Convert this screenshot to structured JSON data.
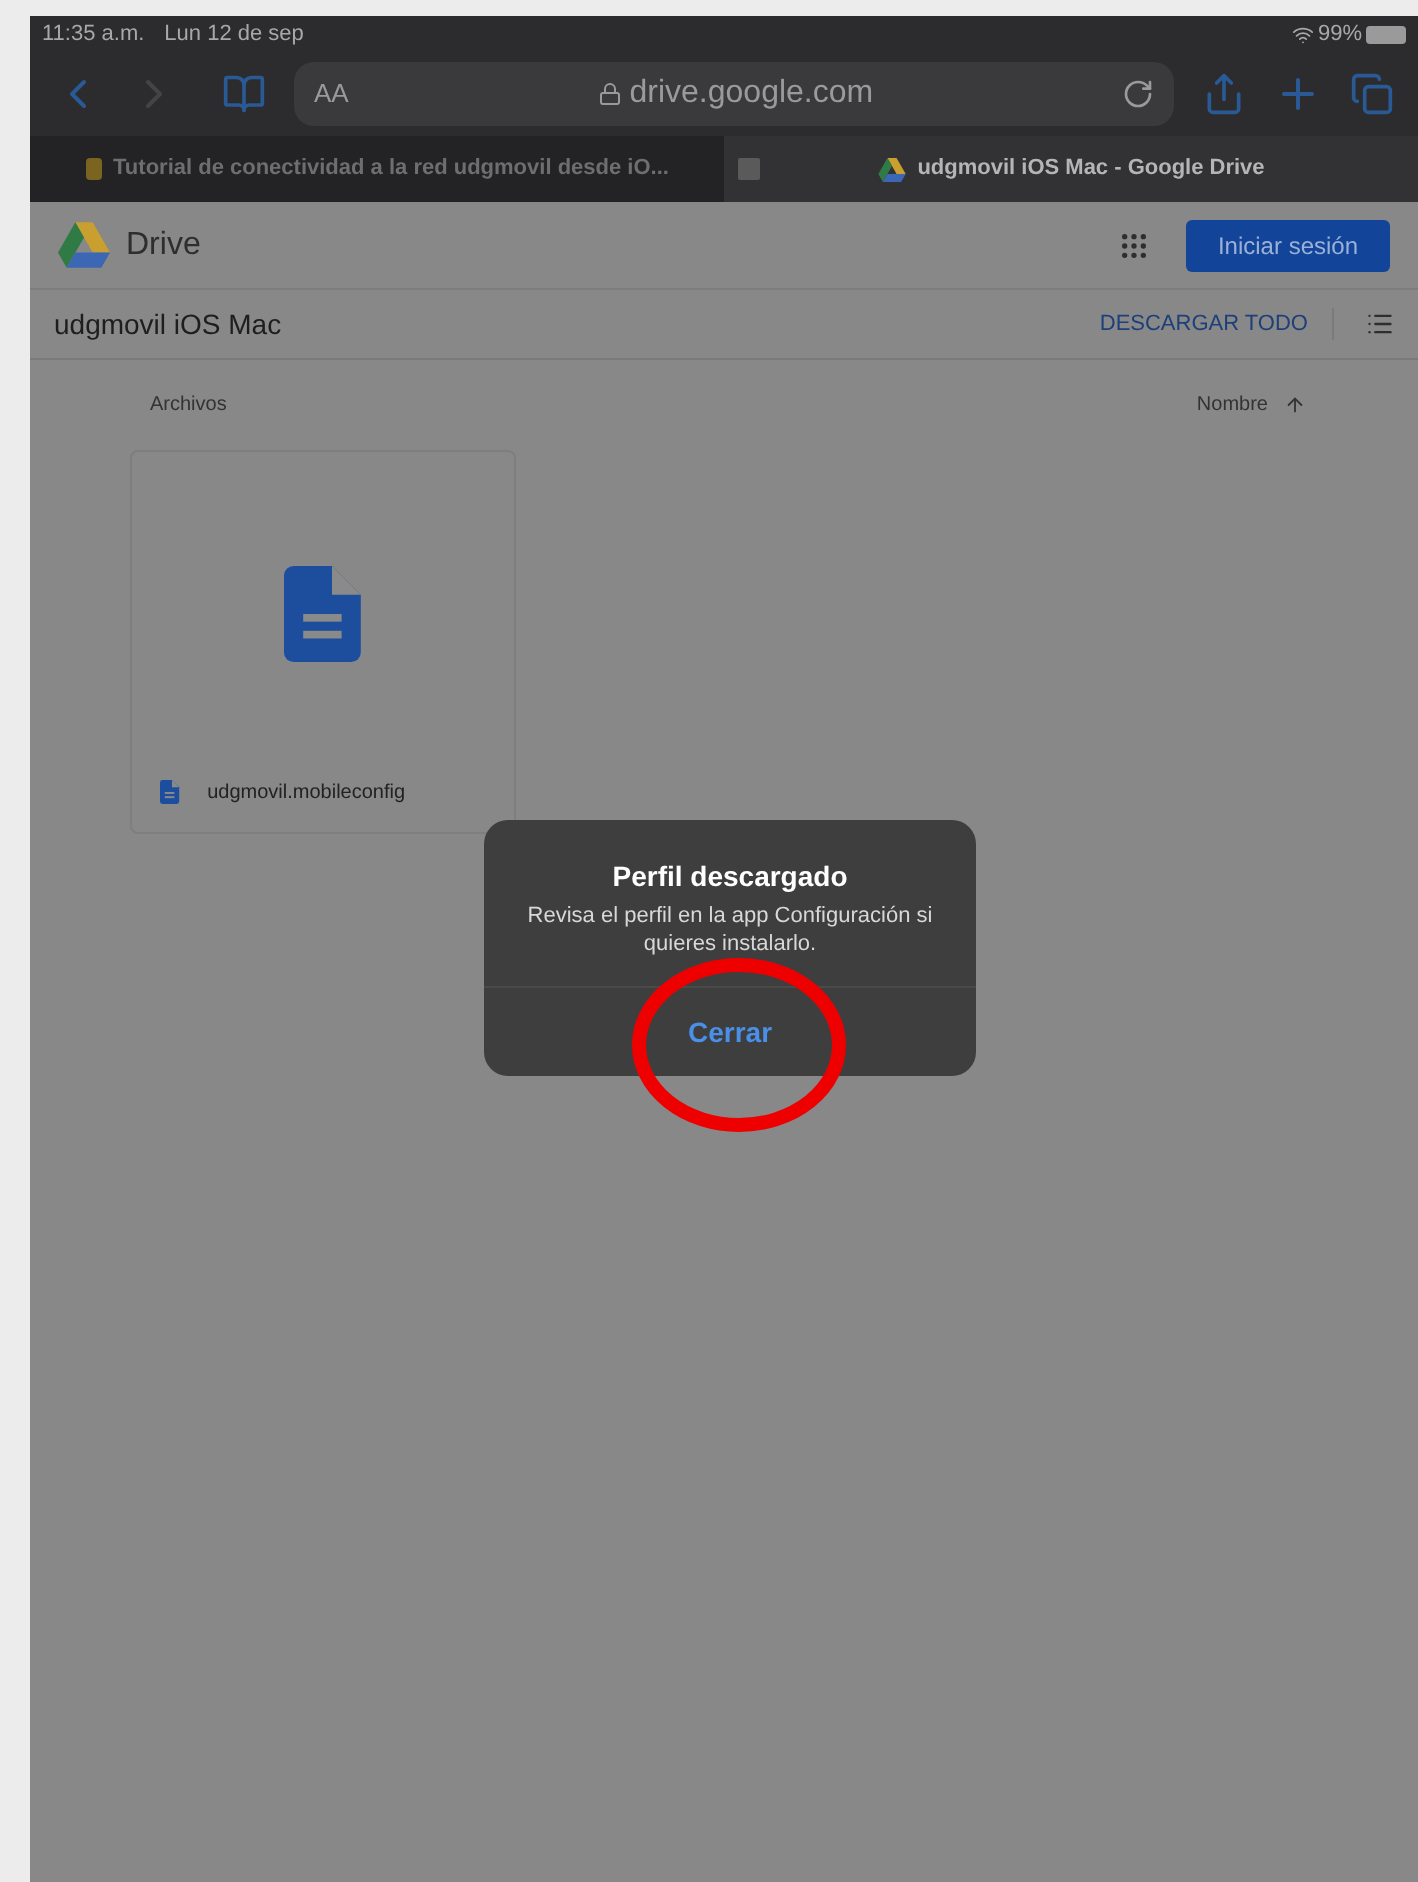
{
  "status_bar": {
    "time": "11:35 a.m.",
    "date": "Lun 12 de sep",
    "battery": "99%"
  },
  "toolbar": {
    "text_size": "AA",
    "address": "drive.google.com"
  },
  "tabs": [
    {
      "title": "Tutorial de conectividad a la red udgmovil desde iO...",
      "selected": false
    },
    {
      "title": "udgmovil iOS Mac - Google Drive",
      "selected": true
    }
  ],
  "drive_header": {
    "brand": "Drive",
    "sign_in": "Iniciar sesión"
  },
  "folder": {
    "title": "udgmovil iOS Mac",
    "download_all": "DESCARGAR TODO"
  },
  "list_header": {
    "section": "Archivos",
    "sort": "Nombre"
  },
  "files": [
    {
      "name": "udgmovil.mobileconfig"
    }
  ],
  "alert": {
    "title": "Perfil descargado",
    "message": "Revisa el perfil en la app Configuración si quieres instalarlo.",
    "button": "Cerrar"
  }
}
